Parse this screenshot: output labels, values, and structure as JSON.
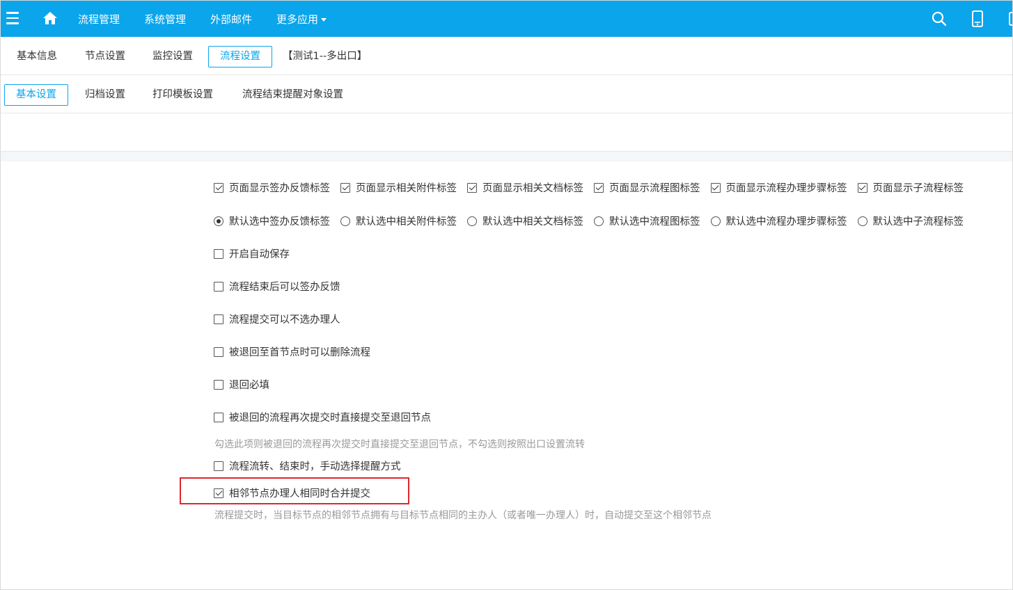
{
  "topbar": {
    "bg_color": "#0aa5eb",
    "menu_icon": "hamburger-menu-icon",
    "home_icon": "home-icon",
    "nav": [
      {
        "label": "流程管理"
      },
      {
        "label": "系统管理"
      },
      {
        "label": "外部邮件"
      },
      {
        "label": "更多应用"
      }
    ],
    "right_icons": [
      "search-icon",
      "mobile-phone-icon"
    ]
  },
  "tabs_row1": {
    "items": [
      {
        "label": "基本信息"
      },
      {
        "label": "节点设置"
      },
      {
        "label": "监控设置"
      },
      {
        "label": "流程设置",
        "active": true
      }
    ],
    "flow_name": "【测试1--多出口】"
  },
  "tabs_row2": {
    "items": [
      {
        "label": "基本设置",
        "active": true
      },
      {
        "label": "归档设置"
      },
      {
        "label": "打印模板设置"
      },
      {
        "label": "流程结束提醒对象设置"
      }
    ]
  },
  "settings": {
    "display_tabs": [
      {
        "label": "页面显示签办反馈标签",
        "checked": true
      },
      {
        "label": "页面显示相关附件标签",
        "checked": true
      },
      {
        "label": "页面显示相关文档标签",
        "checked": true
      },
      {
        "label": "页面显示流程图标签",
        "checked": true
      },
      {
        "label": "页面显示流程办理步骤标签",
        "checked": true
      },
      {
        "label": "页面显示子流程标签",
        "checked": true
      }
    ],
    "default_tab": [
      {
        "label": "默认选中签办反馈标签",
        "selected": true
      },
      {
        "label": "默认选中相关附件标签",
        "selected": false
      },
      {
        "label": "默认选中相关文档标签",
        "selected": false
      },
      {
        "label": "默认选中流程图标签",
        "selected": false
      },
      {
        "label": "默认选中流程办理步骤标签",
        "selected": false
      },
      {
        "label": "默认选中子流程标签",
        "selected": false
      }
    ],
    "options": [
      {
        "label": "开启自动保存",
        "checked": false
      },
      {
        "label": "流程结束后可以签办反馈",
        "checked": false
      },
      {
        "label": "流程提交可以不选办理人",
        "checked": false
      },
      {
        "label": "被退回至首节点时可以删除流程",
        "checked": false
      },
      {
        "label": "退回必填",
        "checked": false
      },
      {
        "label": "被退回的流程再次提交时直接提交至退回节点",
        "checked": false
      }
    ],
    "hint_return": "勾选此项则被退回的流程再次提交时直接提交至退回节点，不勾选则按照出口设置流转",
    "option_remind": {
      "label": "流程流转、结束时，手动选择提醒方式",
      "checked": false
    },
    "option_merge": {
      "label": "相邻节点办理人相同时合并提交",
      "checked": true
    },
    "hint_merge": "流程提交时，当目标节点的相邻节点拥有与目标节点相同的主办人（或者唯一办理人）时，自动提交至这个相邻节点",
    "highlight_color": "#e0262b"
  }
}
